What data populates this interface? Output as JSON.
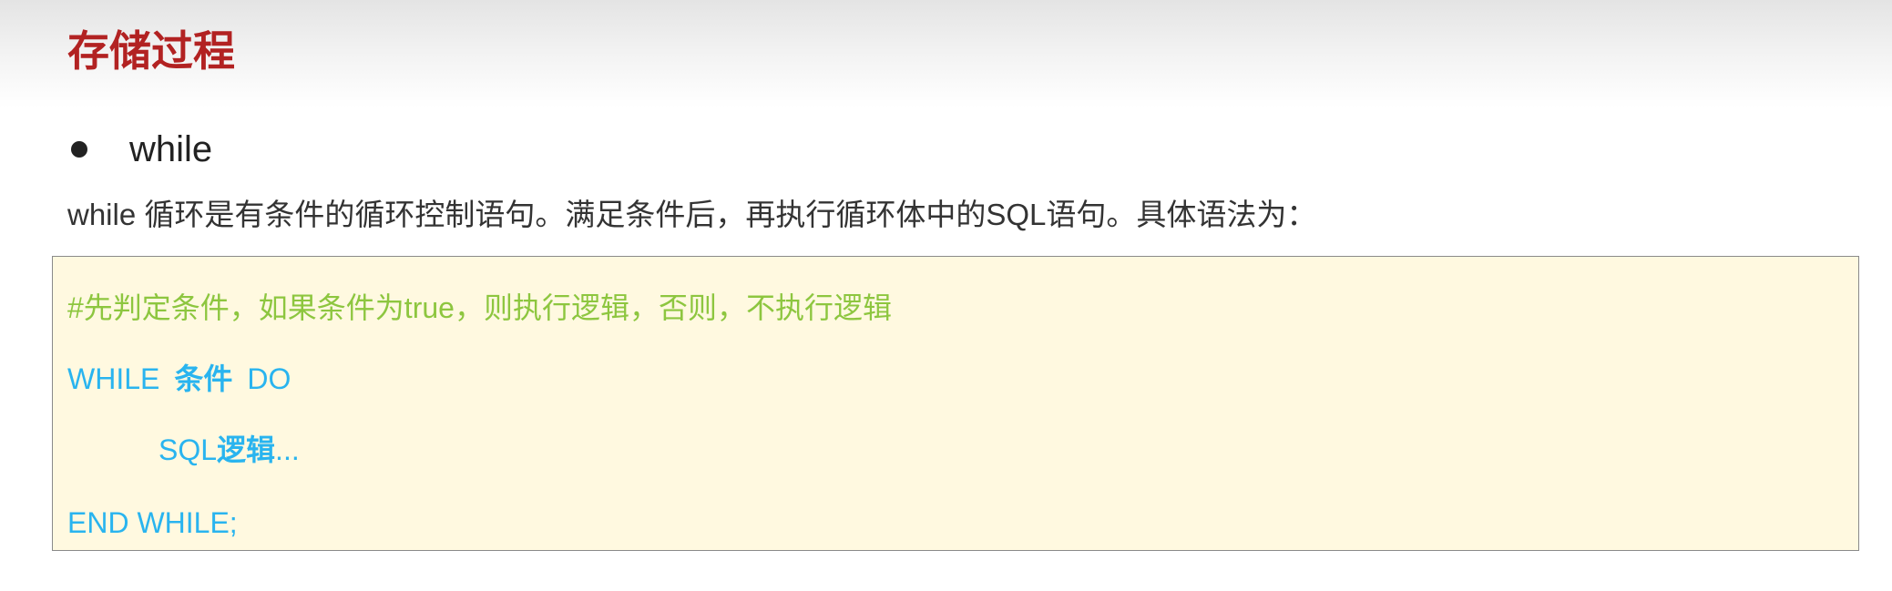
{
  "slide": {
    "title": "存储过程",
    "bullet": "while",
    "description": "while 循环是有条件的循环控制语句。满足条件后，再执行循环体中的SQL语句。具体语法为："
  },
  "code": {
    "comment": "#先判定条件，如果条件为true，则执行逻辑，否则，不执行逻辑",
    "while_keyword": "WHILE",
    "condition": "条件",
    "do_keyword": "DO",
    "body_sql": "SQL",
    "body_logic": "逻辑",
    "body_ellipsis": "...",
    "end_line": "END WHILE;"
  },
  "colors": {
    "title": "#b22222",
    "comment": "#8dc63f",
    "keyword": "#29b4ef",
    "code_background": "#fff9e0"
  }
}
